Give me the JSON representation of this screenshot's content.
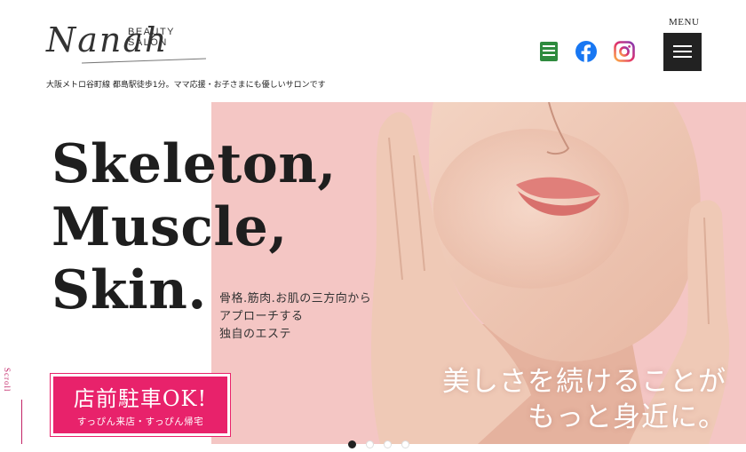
{
  "header": {
    "brand_small": "BEAUTY SALON",
    "brand_script": "Nanah",
    "tagline": "大阪メトロ谷町線 都島駅徒歩1分。ママ応援・お子さまにも優しいサロンです",
    "menu_label": "MENU",
    "social": [
      {
        "icon": "book-icon",
        "color": "#2e8b3e"
      },
      {
        "icon": "facebook-icon",
        "color": "#1877f2"
      },
      {
        "icon": "instagram-icon",
        "color": "#d6249f"
      }
    ]
  },
  "hero": {
    "headline_1": "Skeleton,",
    "headline_2": "Muscle,",
    "headline_3": "Skin.",
    "sub_1": "骨格.筋肉.お肌の三方向から",
    "sub_2": "アプローチする",
    "sub_3": "独自のエステ",
    "overlay_1": "美しさを続けることが",
    "overlay_2": "もっと身近に。",
    "scroll_label": "Scroll",
    "slider_dots": 4,
    "active_dot": 1
  },
  "parking": {
    "title": "店前駐車OK!",
    "subtitle": "すっぴん来店・すっぴん帰宅"
  },
  "colors": {
    "accent": "#e8226b",
    "hero_bg": "#f4c6c4",
    "skin": "#efc9b6"
  }
}
